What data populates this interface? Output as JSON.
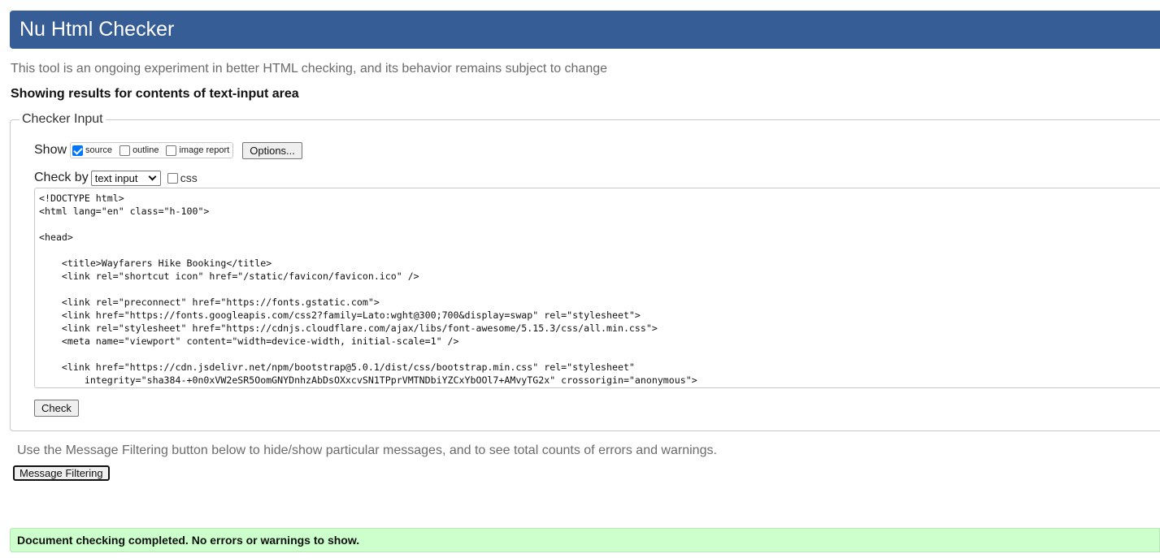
{
  "header": {
    "title": "Nu Html Checker"
  },
  "tagline": "This tool is an ongoing experiment in better HTML checking, and its behavior remains subject to change",
  "results_heading": "Showing results for contents of text-input area",
  "checker_input": {
    "legend": "Checker Input",
    "show_label": "Show",
    "options": [
      {
        "label": "source",
        "checked": true
      },
      {
        "label": "outline",
        "checked": false
      },
      {
        "label": "image report",
        "checked": false
      }
    ],
    "options_button": "Options...",
    "check_by_label": "Check by",
    "check_by_selected": "text input",
    "css_label": "css",
    "css_checked": false,
    "source_lines": [
      "<!DOCTYPE html>",
      "<html lang=\"en\" class=\"h-100\">",
      "",
      "<head>",
      "",
      "    <title>Wayfarers Hike Booking</title>",
      "    <link rel=\"shortcut icon\" href=\"/static/favicon/favicon.ico\" />",
      "",
      "    <link rel=\"preconnect\" href=\"https://fonts.gstatic.com\">",
      "    <link href=\"https://fonts.googleapis.com/css2?family=Lato:wght@300;700&display=swap\" rel=\"stylesheet\">",
      "    <link rel=\"stylesheet\" href=\"https://cdnjs.cloudflare.com/ajax/libs/font-awesome/5.15.3/css/all.min.css\">",
      "    <meta name=\"viewport\" content=\"width=device-width, initial-scale=1\" />",
      "",
      "    <link href=\"https://cdn.jsdelivr.net/npm/bootstrap@5.0.1/dist/css/bootstrap.min.css\" rel=\"stylesheet\"",
      "        integrity=\"sha384-+0n0xVW2eSR5OomGNYDnhzAbDsOXxcvSN1TPprVMTNDbiYZCxYbOOl7+AMvyTG2x\" crossorigin=\"anonymous\">"
    ],
    "check_button": "Check"
  },
  "filter_note": "Use the Message Filtering button below to hide/show particular messages, and to see total counts of errors and warnings.",
  "filter_button": "Message Filtering",
  "result_message": "Document checking completed. No errors or warnings to show."
}
